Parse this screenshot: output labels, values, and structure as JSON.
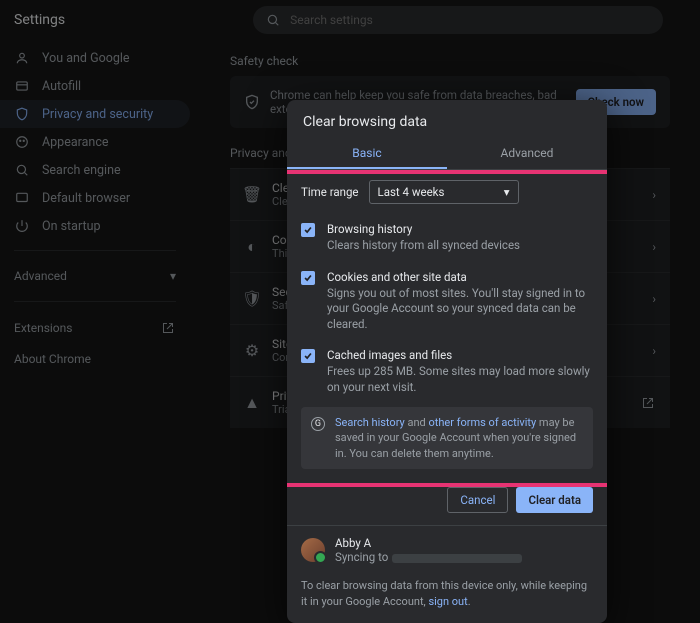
{
  "page_title": "Settings",
  "search": {
    "placeholder": "Search settings"
  },
  "sidebar": {
    "items": [
      {
        "label": "You and Google"
      },
      {
        "label": "Autofill"
      },
      {
        "label": "Privacy and security"
      },
      {
        "label": "Appearance"
      },
      {
        "label": "Search engine"
      },
      {
        "label": "Default browser"
      },
      {
        "label": "On startup"
      }
    ],
    "advanced": "Advanced",
    "extensions": "Extensions",
    "about": "About Chrome"
  },
  "safety": {
    "heading": "Safety check",
    "text": "Chrome can help keep you safe from data breaches, bad extensions, and more",
    "button": "Check now"
  },
  "ps_heading": "Privacy and s",
  "rows": [
    {
      "title": "Clea",
      "sub": "Clea"
    },
    {
      "title": "Coo",
      "sub": "Thi"
    },
    {
      "title": "Sec",
      "sub": "Safe"
    },
    {
      "title": "Site",
      "sub": "Con"
    },
    {
      "title": "Priv",
      "sub": "Trial"
    }
  ],
  "dialog": {
    "title": "Clear browsing data",
    "tabs": {
      "basic": "Basic",
      "advanced": "Advanced"
    },
    "time_range_label": "Time range",
    "time_range_value": "Last 4 weeks",
    "options": [
      {
        "title": "Browsing history",
        "desc": "Clears history from all synced devices"
      },
      {
        "title": "Cookies and other site data",
        "desc": "Signs you out of most sites. You'll stay signed in to your Google Account so your synced data can be cleared."
      },
      {
        "title": "Cached images and files",
        "desc": "Frees up 285 MB. Some sites may load more slowly on your next visit."
      }
    ],
    "notice": {
      "link1": "Search history",
      "mid": " and ",
      "link2": "other forms of activity",
      "rest": " may be saved in your Google Account when you're signed in. You can delete them anytime."
    },
    "buttons": {
      "cancel": "Cancel",
      "clear": "Clear data"
    },
    "sync": {
      "name": "Abby A",
      "status": "Syncing to"
    },
    "foot": {
      "pre": "To clear browsing data from this device only, while keeping it in your Google Account, ",
      "link": "sign out",
      "post": "."
    }
  }
}
